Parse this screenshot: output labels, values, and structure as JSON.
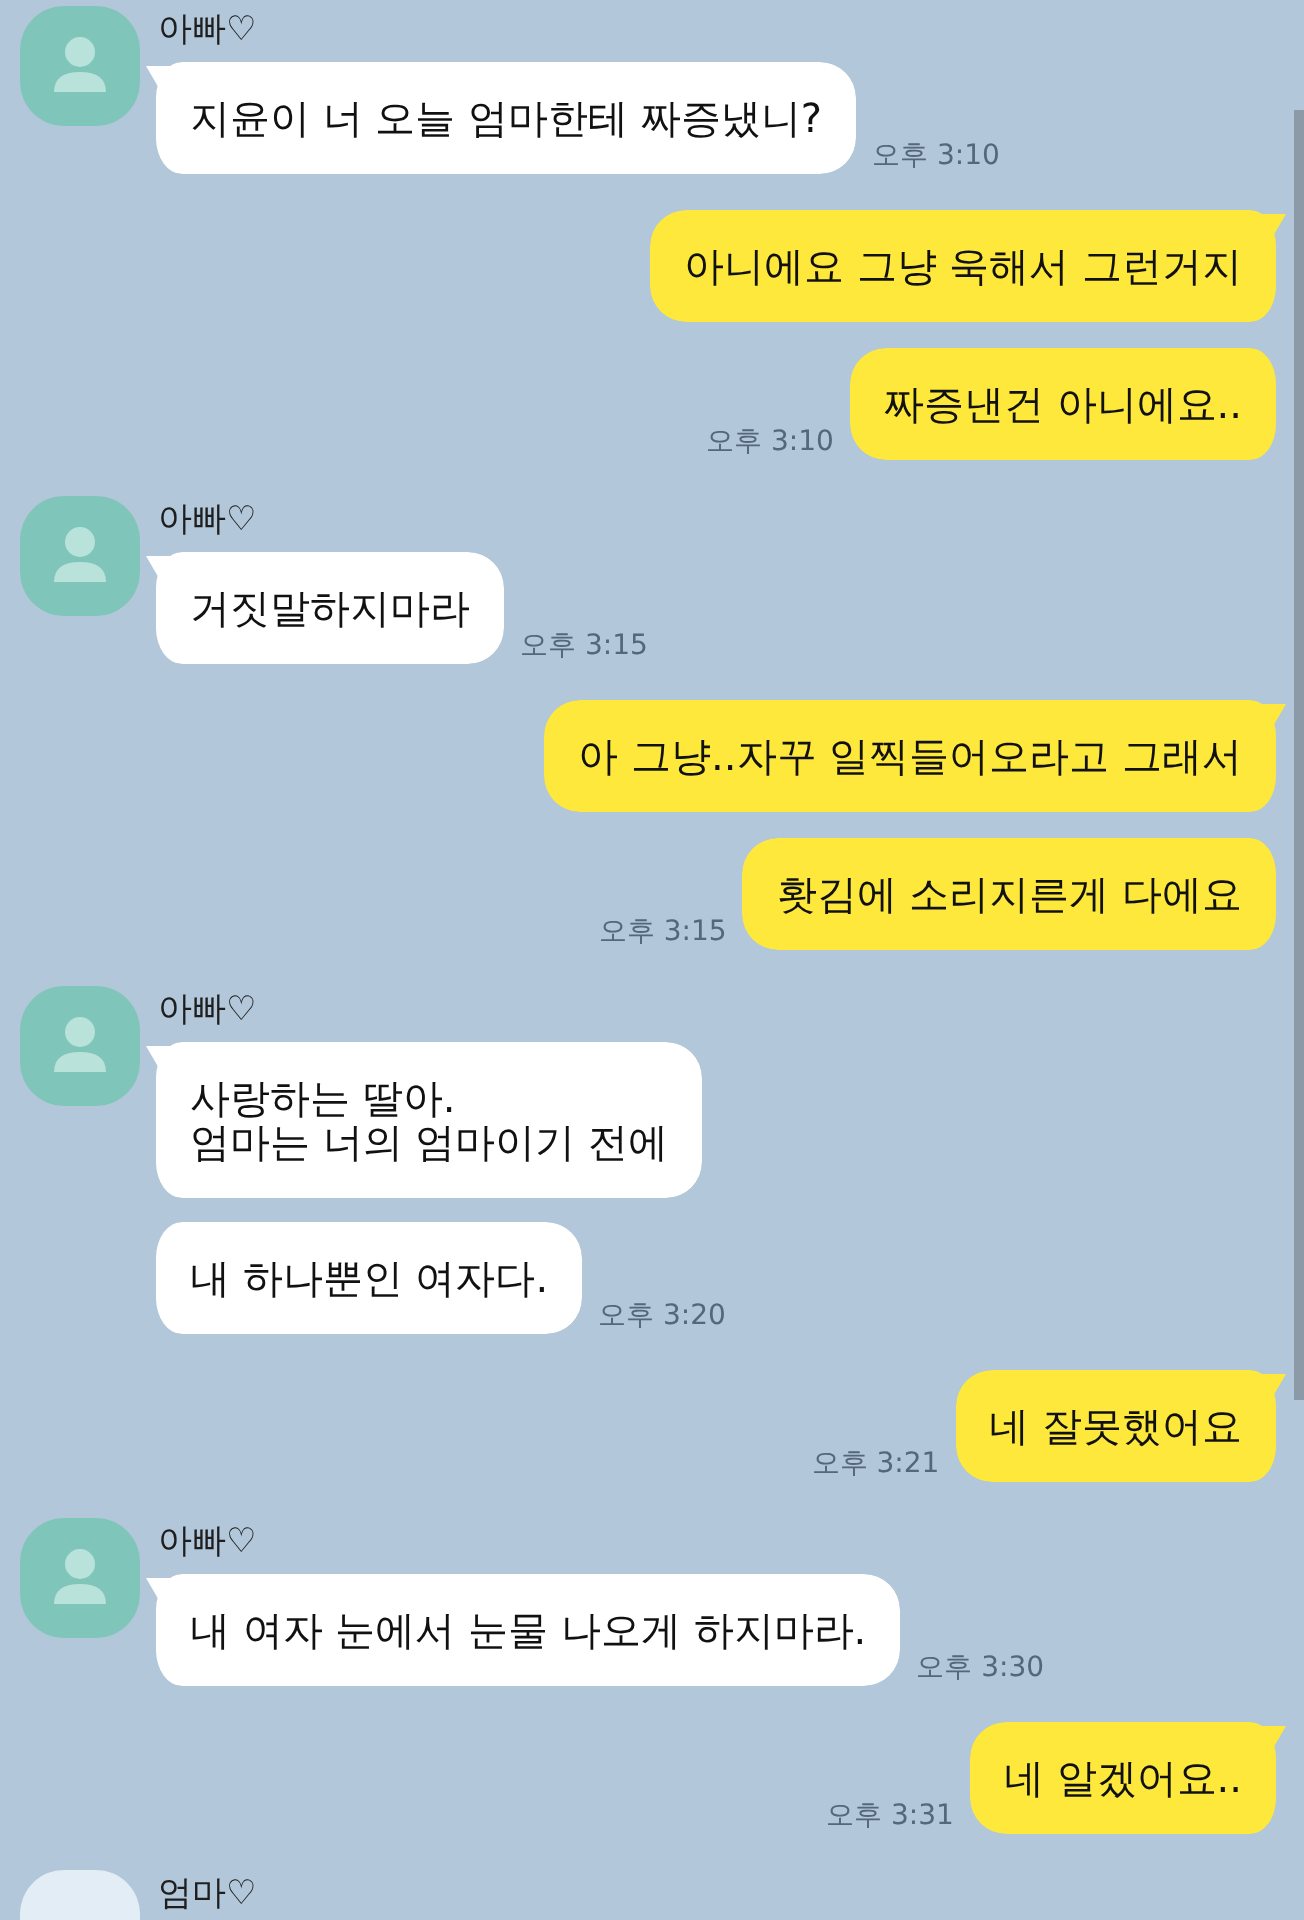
{
  "messages": [
    {
      "kind": "received",
      "sender": "아빠♡",
      "avatar": {
        "kind": "default"
      },
      "bubbles": [
        "지윤이 너 오늘 엄마한테 짜증냈니?"
      ],
      "time": "오후 3:10"
    },
    {
      "kind": "sent",
      "bubbles": [
        "아니에요 그냥 욱해서 그런거지",
        "짜증낸건 아니에요.."
      ],
      "time": "오후 3:10"
    },
    {
      "kind": "received",
      "sender": "아빠♡",
      "avatar": {
        "kind": "default"
      },
      "bubbles": [
        "거짓말하지마라"
      ],
      "time": "오후 3:15"
    },
    {
      "kind": "sent",
      "bubbles": [
        "아 그냥..자꾸 일찍들어오라고 그래서",
        "홧김에 소리지른게 다에요"
      ],
      "time": "오후 3:15"
    },
    {
      "kind": "received",
      "sender": "아빠♡",
      "avatar": {
        "kind": "default"
      },
      "bubbles": [
        "사랑하는 딸아.\n엄마는 너의 엄마이기 전에",
        "내 하나뿐인 여자다."
      ],
      "time": "오후 3:20"
    },
    {
      "kind": "sent",
      "bubbles": [
        "네 잘못했어요"
      ],
      "time": "오후 3:21"
    },
    {
      "kind": "received",
      "sender": "아빠♡",
      "avatar": {
        "kind": "default"
      },
      "bubbles": [
        "내 여자 눈에서 눈물 나오게 하지마라."
      ],
      "time": "오후 3:30"
    },
    {
      "kind": "sent",
      "bubbles": [
        "네 알겠어요.."
      ],
      "time": "오후 3:31"
    },
    {
      "kind": "received",
      "sender": "엄마♡",
      "avatar": {
        "kind": "photo"
      }
    }
  ]
}
